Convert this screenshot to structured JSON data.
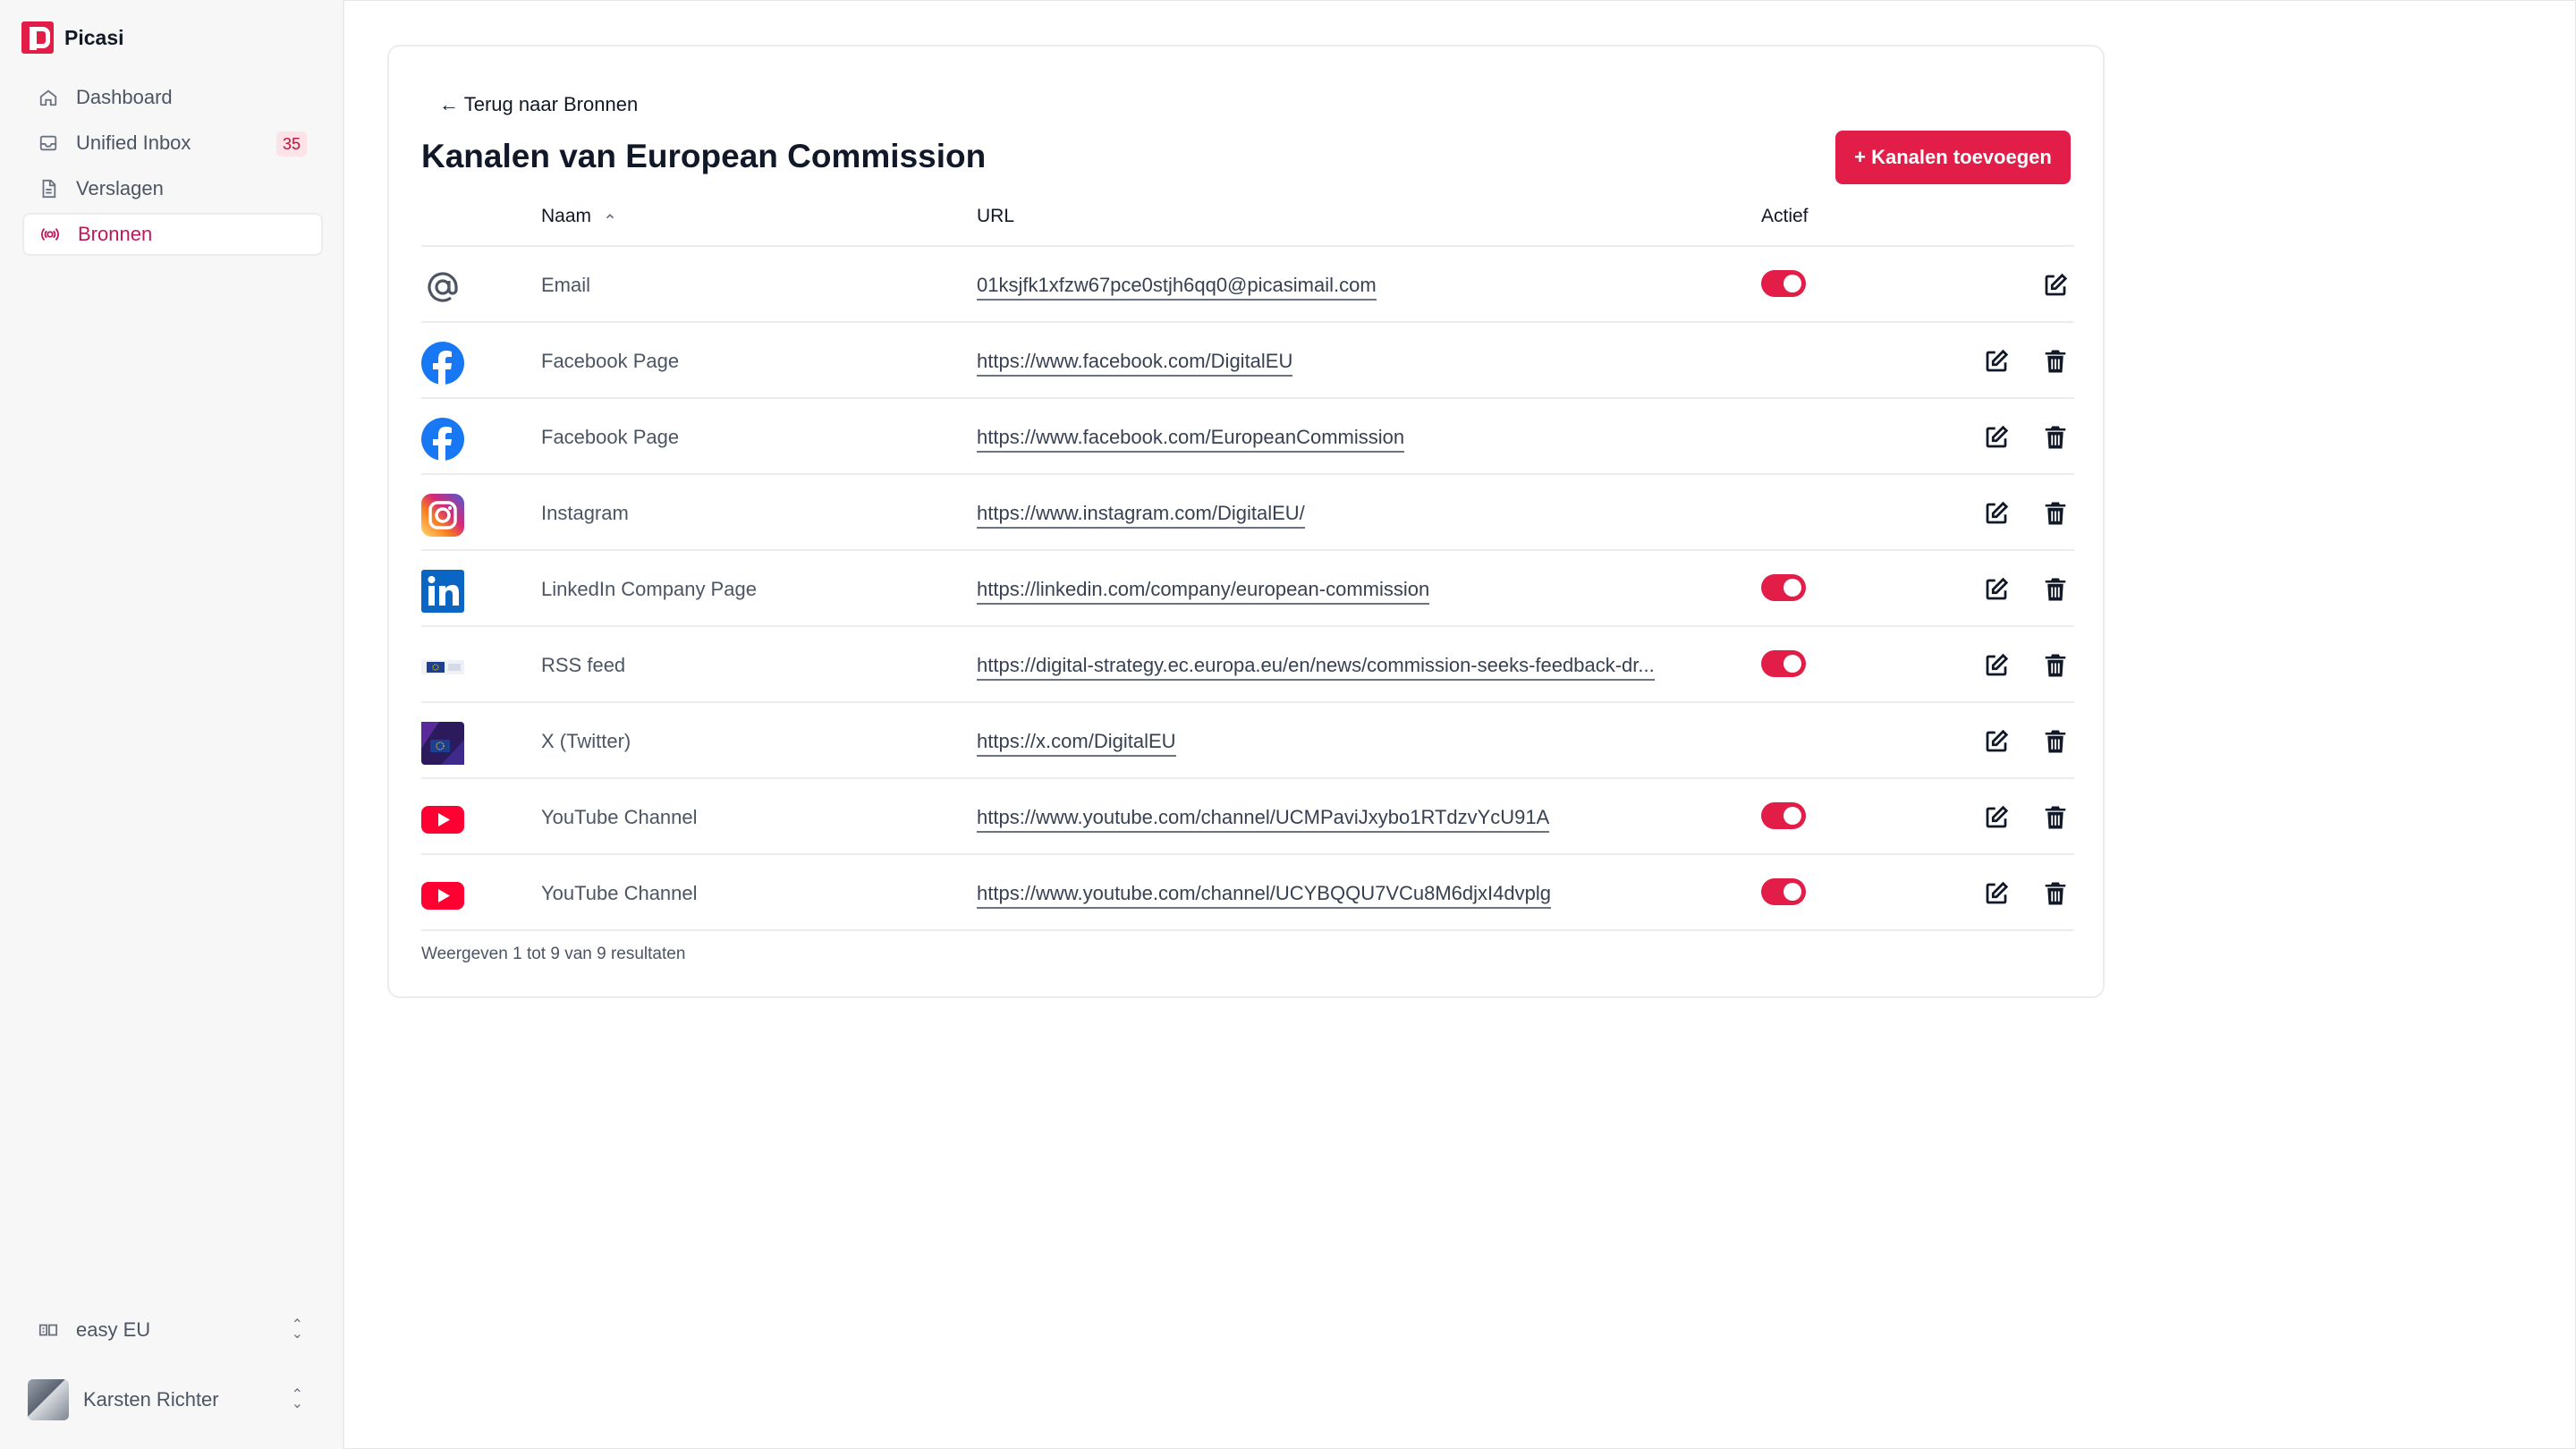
{
  "app": {
    "name": "Picasi"
  },
  "sidebar": {
    "items": [
      {
        "label": "Dashboard",
        "icon": "home-icon"
      },
      {
        "label": "Unified Inbox",
        "icon": "inbox-icon",
        "badge": "35"
      },
      {
        "label": "Verslagen",
        "icon": "document-icon"
      },
      {
        "label": "Bronnen",
        "icon": "sources-icon",
        "active": true
      }
    ],
    "workspace": {
      "label": "easy EU",
      "icon": "workspace-icon"
    },
    "user": {
      "name": "Karsten Richter"
    }
  },
  "page": {
    "back_link": "← Terug naar Bronnen",
    "title": "Kanalen van European Commission",
    "add_button": "+ Kanalen toevoegen",
    "accent_color": "#e11d48"
  },
  "table": {
    "columns": {
      "name": "Naam",
      "url": "URL",
      "active": "Actief",
      "sort_icon": "chevron-up-icon"
    },
    "rows": [
      {
        "icon": "at-sign-icon",
        "name": "Email",
        "url": "01ksjfk1xfzw67pce0stjh6qq0@picasimail.com",
        "active": true,
        "deletable": false
      },
      {
        "icon": "facebook-icon",
        "name": "Facebook Page",
        "url": "https://www.facebook.com/DigitalEU",
        "active": false,
        "deletable": true
      },
      {
        "icon": "facebook-icon",
        "name": "Facebook Page",
        "url": "https://www.facebook.com/EuropeanCommission",
        "active": false,
        "deletable": true
      },
      {
        "icon": "instagram-icon",
        "name": "Instagram",
        "url": "https://www.instagram.com/DigitalEU/",
        "active": false,
        "deletable": true
      },
      {
        "icon": "linkedin-icon",
        "name": "LinkedIn Company Page",
        "url": "https://linkedin.com/company/european-commission",
        "active": true,
        "deletable": true
      },
      {
        "icon": "eu-flag-icon",
        "name": "RSS feed",
        "url": "https://digital-strategy.ec.europa.eu/en/news/commission-seeks-feedback-dr...",
        "active": true,
        "deletable": true
      },
      {
        "icon": "x-avatar-icon",
        "name": "X (Twitter)",
        "url": "https://x.com/DigitalEU",
        "active": false,
        "deletable": true
      },
      {
        "icon": "youtube-icon",
        "name": "YouTube Channel",
        "url": "https://www.youtube.com/channel/UCMPaviJxybo1RTdzvYcU91A",
        "active": true,
        "deletable": true
      },
      {
        "icon": "youtube-icon",
        "name": "YouTube Channel",
        "url": "https://www.youtube.com/channel/UCYBQQU7VCu8M6djxI4dvplg",
        "active": true,
        "deletable": true
      }
    ],
    "footer": "Weergeven 1 tot 9 van 9 resultaten"
  }
}
